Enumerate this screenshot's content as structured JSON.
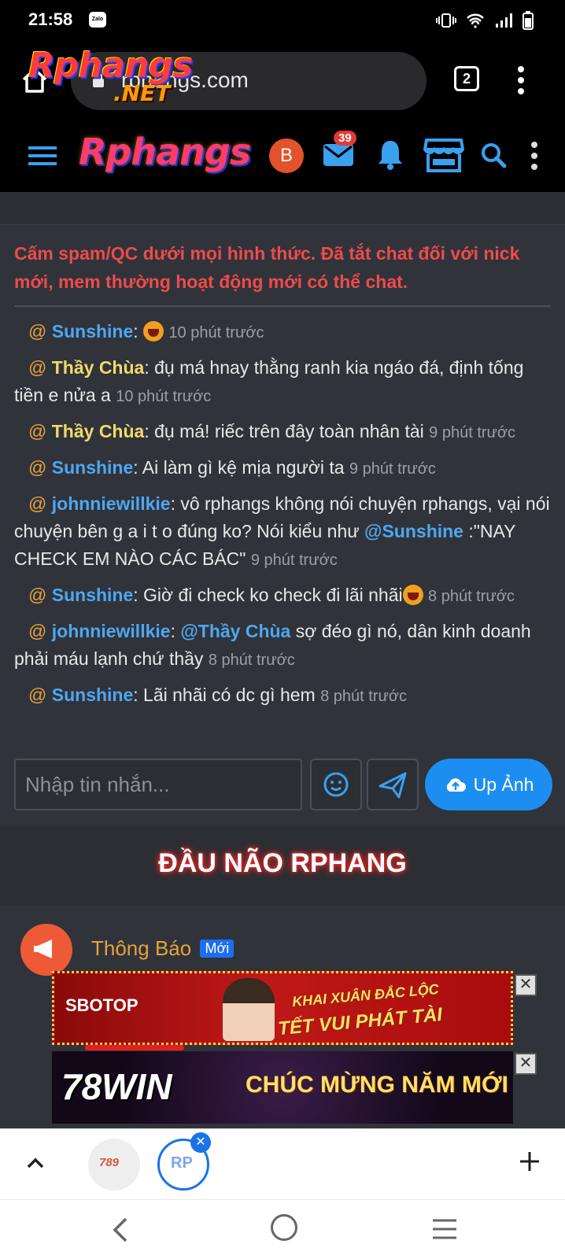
{
  "status_bar": {
    "time": "21:58",
    "zalo_label": "Zalo"
  },
  "browser": {
    "url": "rphangs.com",
    "logo_text": "Rphangs",
    "logo_suffix": ".NET",
    "tab_count": "2"
  },
  "forum_header": {
    "logo_text": "Rphangs",
    "avatar_letter": "B",
    "mail_badge": "39"
  },
  "chat": {
    "notice": "Cấm spam/QC dưới mọi hình thức. Đã tắt chat đối với nick mới, mem thường hoạt động mới có thể chat.",
    "messages": [
      {
        "at": "@",
        "user": "Sunshine",
        "sep": ":",
        "text": "",
        "time": "10 phút trước"
      },
      {
        "at": "@",
        "user": "Thầy Chùa",
        "sep": ":",
        "text": " đụ má hnay thằng ranh kia ngáo đá, định tống tiền e nửa a",
        "time": "10 phút trước"
      },
      {
        "at": "@",
        "user": "Thầy Chùa",
        "sep": ":",
        "text": " đụ má! riếc trên đây toàn nhân tài",
        "time": "9 phút trước"
      },
      {
        "at": "@",
        "user": "Sunshine",
        "sep": ":",
        "text": " Ai làm gì kệ mịa người ta",
        "time": "9 phút trước"
      },
      {
        "at": "@",
        "user": "johnniewillkie",
        "sep": ":",
        "text": " vô rphangs không nói chuyện rphangs, vại nói chuyện bên g a i t o đúng ko? Nói kiểu như ",
        "mention": "@Sunshine",
        "text2": " :\"NAY CHECK EM NÀO CÁC BÁC\"",
        "time": "9 phút trước"
      },
      {
        "at": "@",
        "user": "Sunshine",
        "sep": ":",
        "text": " Giờ đi check ko check đi lãi nhãi",
        "time": "8 phút trước"
      },
      {
        "at": "@",
        "user": "johnniewillkie",
        "sep": ":",
        "text": " ",
        "mention": "@Thầy Chùa",
        "text2": " sợ đéo gì nó, dân kinh doanh phải máu lạnh chứ thầy",
        "time": "8 phút trước"
      },
      {
        "at": "@",
        "user": "Sunshine",
        "sep": ":",
        "text": " Lãi nhãi có dc gì hem",
        "time": "8 phút trước"
      }
    ],
    "input_placeholder": "Nhập tin nhắn...",
    "upload_label": "Up Ảnh"
  },
  "section": {
    "title": "ĐẦU NÃO RPHANG"
  },
  "post": {
    "title": "Thông Báo",
    "badge": "Mới"
  },
  "ads": [
    {
      "brand": "SBOTOP",
      "slogan_top": "KHAI XUÂN ĐẮC LỘC",
      "slogan_bottom": "TẾT VUI PHÁT TÀI",
      "close": "✕"
    },
    {
      "brand": "78WIN",
      "slogan": "CHÚC MỪNG NĂM MỚI",
      "close": "✕"
    }
  ],
  "tabs": {
    "tab1_label": "789",
    "tab2_label": "RP",
    "close": "✕"
  },
  "colors": {
    "accent_blue": "#1c8ef2",
    "notice_red": "#ee4b4b",
    "username_blue": "#4ea7f0",
    "username_yellow": "#f2d96b"
  }
}
